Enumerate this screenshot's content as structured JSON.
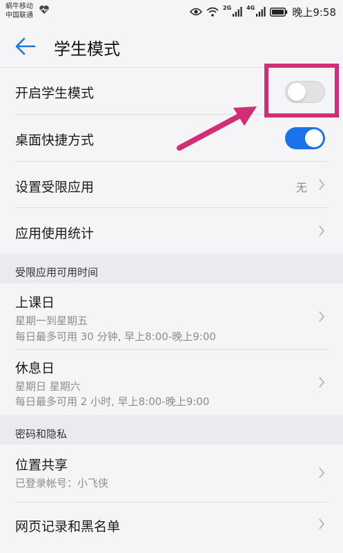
{
  "status": {
    "carrier1": "蜗牛移动",
    "carrier2": "中国联通",
    "net1": "2G",
    "net2": "4G",
    "time": "晚上9:58"
  },
  "header": {
    "title": "学生模式"
  },
  "rows": {
    "student_mode": {
      "label": "开启学生模式",
      "state": "off"
    },
    "shortcut": {
      "label": "桌面快捷方式",
      "state": "on"
    },
    "restricted_apps": {
      "label": "设置受限应用",
      "value": "无"
    },
    "app_stats": {
      "label": "应用使用统计"
    }
  },
  "section_time": {
    "title": "受限应用可用时间"
  },
  "schooldays": {
    "label": "上课日",
    "days": "星期一到星期五",
    "limit": "每日最多可用 30 分钟, 早上8:00-晚上9:00"
  },
  "restdays": {
    "label": "休息日",
    "days": "星期日 星期六",
    "limit": "每日最多可用 2 小时, 早上8:00-晚上9:00"
  },
  "section_privacy": {
    "title": "密码和隐私"
  },
  "location": {
    "label": "位置共享",
    "account": "已登录帐号：小飞侠"
  },
  "web_records": {
    "label": "网页记录和黑名单"
  },
  "colors": {
    "accent": "#1a73e8",
    "annotation": "#d22e78"
  }
}
